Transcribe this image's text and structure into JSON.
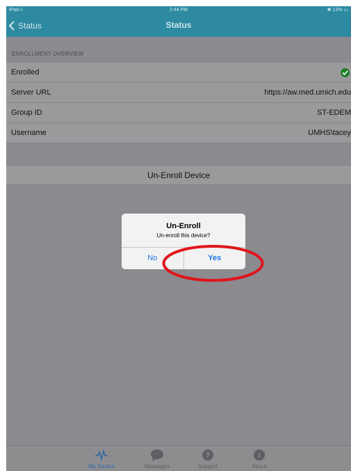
{
  "status_bar": {
    "device": "iPad",
    "time": "2:44 PM",
    "battery": "13%"
  },
  "nav": {
    "back_label": "Status",
    "title": "Status"
  },
  "section": {
    "header": "ENROLLMENT OVERVIEW"
  },
  "rows": [
    {
      "label": "Enrolled",
      "value": ""
    },
    {
      "label": "Server URL",
      "value": "https://aw.med.umich.edu"
    },
    {
      "label": "Group ID",
      "value": "ST-EDEM"
    },
    {
      "label": "Username",
      "value": "UMHS\\tacey"
    }
  ],
  "unenroll_button": {
    "label": "Un-Enroll Device"
  },
  "alert": {
    "title": "Un-Enroll",
    "message": "Un-enroll this device?",
    "no_label": "No",
    "yes_label": "Yes"
  },
  "tabs": [
    {
      "label": "My Device",
      "icon": "pulse-icon",
      "active": true
    },
    {
      "label": "Messages",
      "icon": "chat-bubble-icon",
      "active": false
    },
    {
      "label": "Support",
      "icon": "question-icon",
      "active": false
    },
    {
      "label": "About",
      "icon": "info-icon",
      "active": false
    }
  ],
  "colors": {
    "nav": "#2d8aa1",
    "annotation": "#e0151b",
    "link": "#1a73e8",
    "check": "#1e7f2a"
  }
}
